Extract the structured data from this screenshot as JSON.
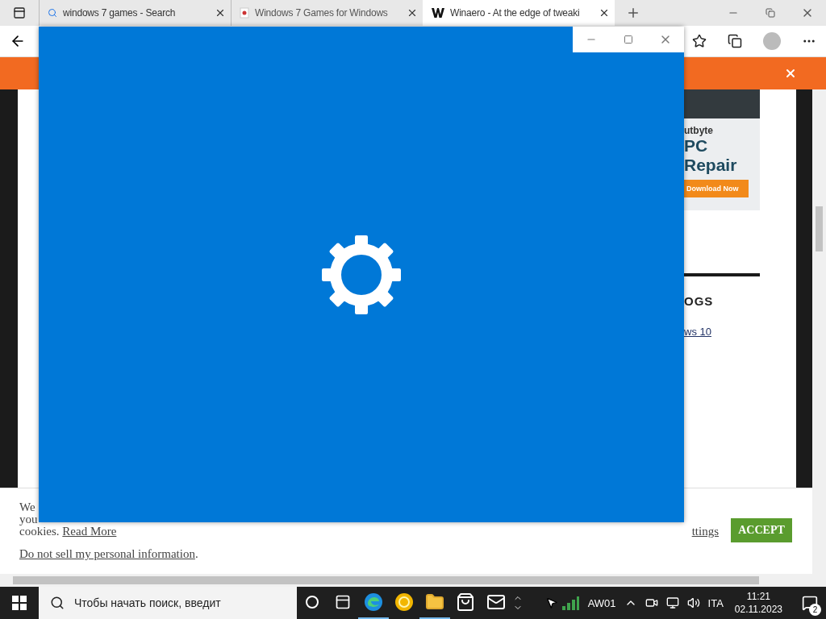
{
  "browser": {
    "tabs": [
      {
        "title": "windows 7 games - Search",
        "kind": "search",
        "selected": false
      },
      {
        "title": "Windows 7 Games for Windows",
        "kind": "cards",
        "selected": false
      },
      {
        "title": "Winaero - At the edge of tweaki",
        "kind": "w",
        "selected": true
      }
    ]
  },
  "ad": {
    "brand": "utbyte",
    "title_1": "PC",
    "title_2": "Repair",
    "button": "Download Now"
  },
  "sidebar": {
    "heading": "OGS",
    "link": "ws 10"
  },
  "cookie_notice": {
    "lines": [
      "We",
      "you"
    ],
    "read_more_prefix": "cookies.",
    "read_more": "Read More",
    "settings_link": "ttings",
    "accept": "ACCEPT",
    "do_not_sell": "Do not sell my personal information",
    "do_not_sell_suffix": "."
  },
  "taskbar": {
    "search_placeholder": "Чтобы начать поиск, введит",
    "pinned": [
      {
        "kind": "edge",
        "running": true
      },
      {
        "kind": "ring",
        "running": false
      },
      {
        "kind": "folder",
        "running": true
      },
      {
        "kind": "store",
        "running": false
      },
      {
        "kind": "mail",
        "running": false
      }
    ],
    "tray": {
      "app_label": "AW01",
      "language": "ITA",
      "time": "11:21",
      "date": "02.11.2023",
      "notifications": "2"
    }
  }
}
